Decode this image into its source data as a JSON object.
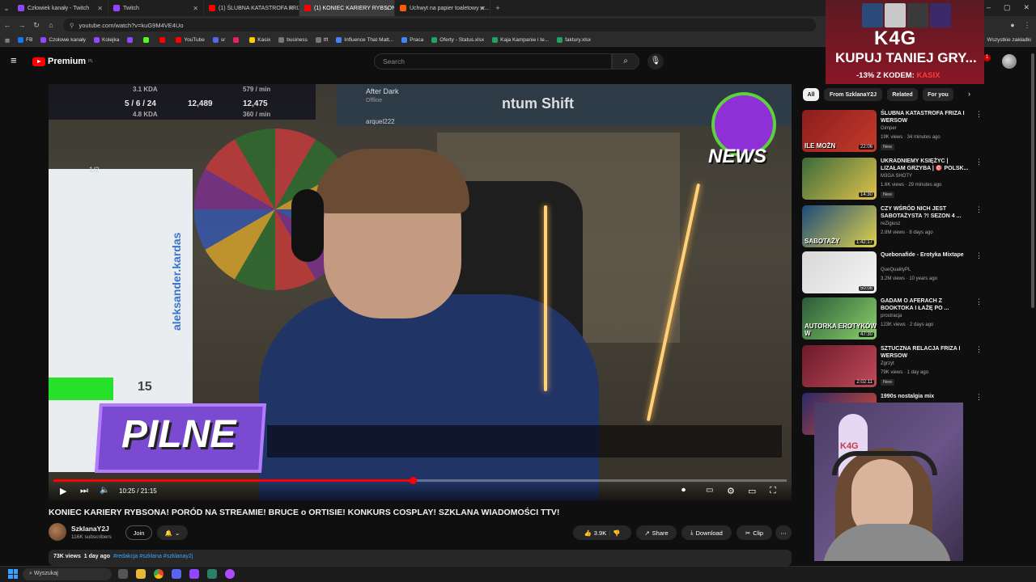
{
  "browser": {
    "tabs": [
      {
        "label": "Człowiek kanały - Twitch",
        "color": "#9146ff",
        "active": false
      },
      {
        "label": "Twitch",
        "color": "#9146ff",
        "active": false
      },
      {
        "label": "(1) ŚLUBNA KATASTROFA FRIZ...",
        "color": "#ff0000",
        "active": false
      },
      {
        "label": "(1) KONIEC KARIERY RYBSONA...",
        "color": "#ff0000",
        "active": true
      },
      {
        "label": "Uchwyt na papier toaletowy w...",
        "color": "#ff5a00",
        "active": false
      }
    ],
    "url": "youtube.com/watch?v=kuG9M4VE4Uo",
    "bookmarks": [
      {
        "label": "FB",
        "color": "#1877f2"
      },
      {
        "label": "Czołowe kanały",
        "color": "#9146ff"
      },
      {
        "label": "Kolejka",
        "color": "#9146ff"
      },
      {
        "label": "",
        "color": "#9146ff"
      },
      {
        "label": "",
        "color": "#53fc18"
      },
      {
        "label": "",
        "color": "#ff0000"
      },
      {
        "label": "YouTube",
        "color": "#ff0000"
      },
      {
        "label": "sr",
        "color": "#5865f2"
      },
      {
        "label": "",
        "color": "#e91e63"
      },
      {
        "label": "Kasix",
        "color": "#ffcc00"
      },
      {
        "label": "business",
        "color": "#777777"
      },
      {
        "label": "tft",
        "color": "#777777"
      },
      {
        "label": "Influence That Matt...",
        "color": "#4285f4"
      },
      {
        "label": "Praca",
        "color": "#4285f4"
      },
      {
        "label": "Oferty - Status.xlsx",
        "color": "#21a366"
      },
      {
        "label": "Kaja Kampanie i te...",
        "color": "#21a366"
      },
      {
        "label": "faktury.xlsx",
        "color": "#21a366"
      }
    ],
    "all_bookmarks": "Wszystkie zakładki"
  },
  "youtube": {
    "logo": "Premium",
    "logo_sup": "PL",
    "search_placeholder": "Search",
    "notif_count": "1"
  },
  "player": {
    "stats_line1": "3.1 KDA",
    "stats_kda": "5 / 6 / 24",
    "stats_gold1": "12,489",
    "stats_gold2": "12,475",
    "stats_line2": "4.8 KDA",
    "stats_rate1": "579 / min",
    "stats_rate2": "360 / min",
    "stream_user1": "After Dark",
    "stream_user1_status": "Offline",
    "stream_user2": "arquel222",
    "quantum": "ntum Shift",
    "counter": "1/2",
    "side_handle": "aleksander.kardas",
    "green_number": "15",
    "pilne": "PILNE",
    "news": "NEWS",
    "time_current": "10:25",
    "time_total": "21:15",
    "progress": 0.49
  },
  "video": {
    "title": "KONIEC KARIERY RYBSONA! PORÓD NA STREAMIE! BRUCE o ORTISIE! KONKURS COSPLAY! SZKLANA WIADOMOŚCI TTV!",
    "channel": "SzklanaY2J",
    "subscribers": "116K subscribers",
    "join": "Join",
    "likes": "3.9K",
    "share": "Share",
    "download": "Download",
    "clip": "Clip",
    "views": "73K views",
    "age": "1 day ago",
    "hashtags": "#redakcja #szklana #szklanay2j"
  },
  "sidebar": {
    "chips": [
      "All",
      "From SzklanaY2J",
      "Related",
      "For you"
    ],
    "recs": [
      {
        "title": "ŚLUBNA KATASTROFA FRIZA I WERSOW",
        "channel": "Gimper",
        "meta": "19K views · 34 minutes ago",
        "new": "New",
        "duration": "22:06",
        "thumb_text": "ILE MOŻN",
        "color1": "#8a1e1e",
        "color2": "#c63a2a"
      },
      {
        "title": "UKRADNIEMY KSIĘŻYC | LIZAŁAM GRZYBA | 🎯 POLSK...",
        "channel": "M3GA SHOTY",
        "meta": "1.6K views · 29 minutes ago",
        "new": "New",
        "duration": "14:30",
        "thumb_text": "",
        "color1": "#3a6a3a",
        "color2": "#e0c24a"
      },
      {
        "title": "CZY WŚRÓD NICH JEST SABOTAŻYSTA ?! SEZON 4 ...",
        "channel": "reZigiusz",
        "meta": "2.8M views · 8 days ago",
        "new": "",
        "duration": "1:42:17",
        "thumb_text": "SABOTAŻY",
        "color1": "#1e4a7a",
        "color2": "#e0d24a"
      },
      {
        "title": "Quebonafide - Erotyka Mixtape",
        "channel": "QueQualityPL",
        "meta": "3.2M views · 10 years ago",
        "new": "",
        "duration": "50:08",
        "thumb_text": "",
        "color1": "#d8d8d8",
        "color2": "#f4f4f4"
      },
      {
        "title": "GADAM O AFERACH Z BOOKTOKA I ŁAŻĘ PO ...",
        "channel": "prostracja",
        "meta": "123K views · 2 days ago",
        "new": "",
        "duration": "47:30",
        "thumb_text": "AUTORKA EROTYKÓW W",
        "color1": "#2a5a3a",
        "color2": "#8ad06a"
      },
      {
        "title": "SZTUCZNA RELACJA FRIZA I WERSOW",
        "channel": "Zgrzyt",
        "meta": "79K views · 1 day ago",
        "new": "New",
        "duration": "2:02:11",
        "thumb_text": "",
        "color1": "#6a1a2a",
        "color2": "#c24a5a"
      },
      {
        "title": "1990s nostalgia mix",
        "channel": "",
        "meta": "",
        "new": "",
        "duration": "",
        "thumb_text": "",
        "color1": "#2a2a6a",
        "color2": "#e04a2a"
      }
    ]
  },
  "ad": {
    "logo": "K4G",
    "line1": "KUPUJ TANIEJ GRY...",
    "line2_prefix": "-13% Z KODEM: ",
    "line2_code": "KASIX"
  },
  "webcam": {
    "sign": "K4G"
  },
  "taskbar": {
    "search": "Wyszukaj"
  }
}
